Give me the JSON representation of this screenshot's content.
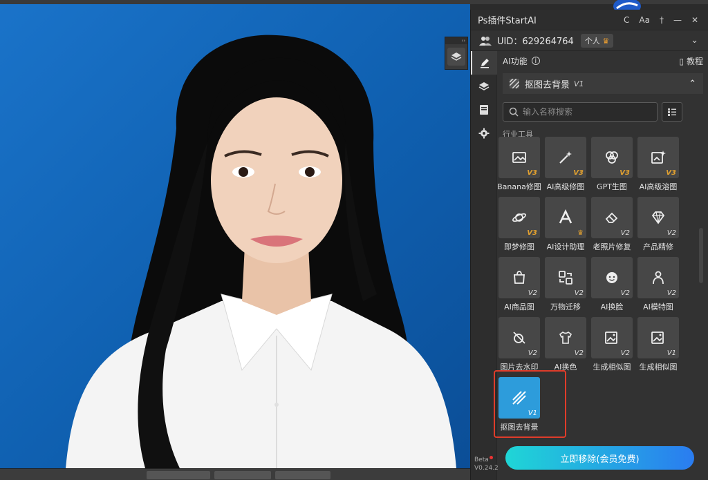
{
  "panel": {
    "title": "Ps插件StartAI",
    "actions": {
      "refresh": "C",
      "font": "Aa",
      "pin": "†",
      "minimize": "—",
      "close": "✕"
    },
    "uid": "UID：629264764",
    "account_badge": "个人",
    "beta_label": "Beta",
    "version": "V0.24.2"
  },
  "mini_panel": {
    "collapse": "››"
  },
  "main": {
    "ai_label": "AI功能",
    "tutorial_label": "教程",
    "section_title": "抠图去背景",
    "section_version": "V1",
    "search_placeholder": "输入名称搜索",
    "industry_label": "行业工具"
  },
  "tools": [
    {
      "label": "Banana修图",
      "version": "V3",
      "icon": "image-edit-icon"
    },
    {
      "label": "AI高级修图",
      "version": "V3",
      "icon": "magic-wand-icon"
    },
    {
      "label": "GPT生图",
      "version": "V3",
      "icon": "gpt-knot-icon"
    },
    {
      "label": "AI高级溶图",
      "version": "V3",
      "icon": "image-sparkle-icon"
    },
    {
      "label": "即梦修图",
      "version": "V3",
      "icon": "planet-icon"
    },
    {
      "label": "AI设计助理",
      "version": "",
      "icon": "letter-a-icon"
    },
    {
      "label": "老照片修复",
      "version": "V2",
      "icon": "eraser-icon"
    },
    {
      "label": "产品精修",
      "version": "V2",
      "icon": "diamond-icon"
    },
    {
      "label": "AI商品图",
      "version": "V2",
      "icon": "shopping-bag-icon"
    },
    {
      "label": "万物迁移",
      "version": "V2",
      "icon": "transfer-icon"
    },
    {
      "label": "AI换脸",
      "version": "V2",
      "icon": "face-icon"
    },
    {
      "label": "AI模特图",
      "version": "V2",
      "icon": "model-person-icon"
    },
    {
      "label": "图片去水印",
      "version": "V2",
      "icon": "watermark-remove-icon"
    },
    {
      "label": "AI换色",
      "version": "V2",
      "icon": "shirt-icon"
    },
    {
      "label": "生成相似图",
      "version": "V2",
      "icon": "similar-image-icon"
    },
    {
      "label": "生成相似图",
      "version": "V1",
      "icon": "similar-image-icon"
    },
    {
      "label": "抠图去背景",
      "version": "V1",
      "icon": "cutout-stripes-icon"
    }
  ],
  "remove_button_label": "立即移除(会员免费)",
  "colors": {
    "accent_blue": "#2d9cdb",
    "version_orange": "#e0a030",
    "highlight_red": "#e03c2a",
    "photo_background": "#1a73c9"
  }
}
